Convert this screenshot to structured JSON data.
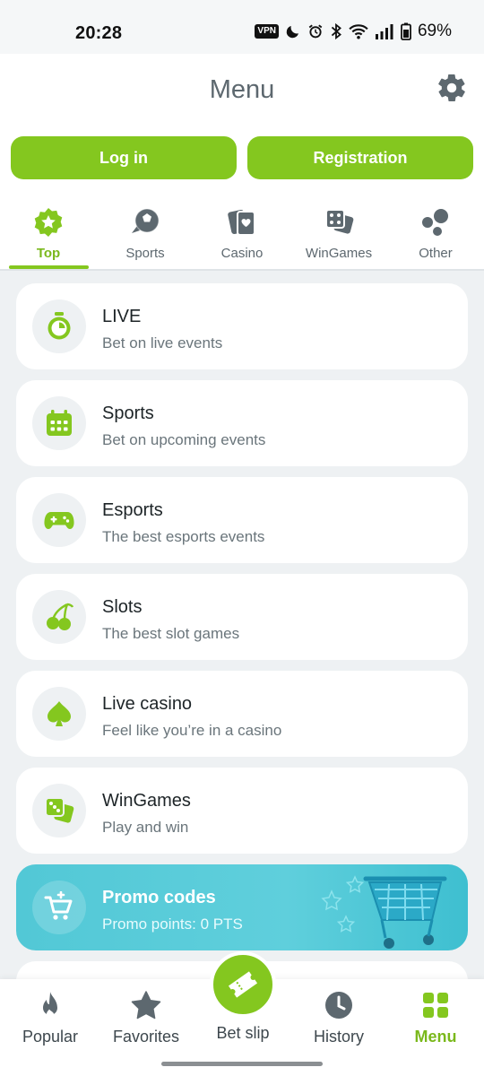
{
  "status": {
    "time": "20:28",
    "vpn": "VPN",
    "battery": "69%"
  },
  "header": {
    "title": "Menu",
    "login_label": "Log in",
    "register_label": "Registration"
  },
  "tabs": [
    {
      "label": "Top",
      "icon": "star-badge-icon",
      "active": true
    },
    {
      "label": "Sports",
      "icon": "soccer-ball-icon",
      "active": false
    },
    {
      "label": "Casino",
      "icon": "playing-cards-icon",
      "active": false
    },
    {
      "label": "WinGames",
      "icon": "dice-icon",
      "active": false
    },
    {
      "label": "Other",
      "icon": "bubbles-icon",
      "active": false
    }
  ],
  "menu": [
    {
      "title": "LIVE",
      "subtitle": "Bet on live events",
      "icon": "stopwatch-icon"
    },
    {
      "title": "Sports",
      "subtitle": "Bet on upcoming events",
      "icon": "calendar-icon"
    },
    {
      "title": "Esports",
      "subtitle": "The best esports events",
      "icon": "gamepad-icon"
    },
    {
      "title": "Slots",
      "subtitle": "The best slot games",
      "icon": "cherries-icon"
    },
    {
      "title": "Live casino",
      "subtitle": "Feel like you’re in a casino",
      "icon": "spade-icon"
    },
    {
      "title": "WinGames",
      "subtitle": "Play and win",
      "icon": "dice-icon"
    }
  ],
  "promo": {
    "title": "Promo codes",
    "subtitle": "Promo points: 0 PTS",
    "icon": "shopping-cart-icon"
  },
  "bottom_nav": {
    "popular": "Popular",
    "favorites": "Favorites",
    "betslip": "Bet slip",
    "history": "History",
    "menu": "Menu"
  },
  "colors": {
    "accent": "#84c71f",
    "promo": "#52c8d6",
    "text_muted": "#5d686f"
  }
}
